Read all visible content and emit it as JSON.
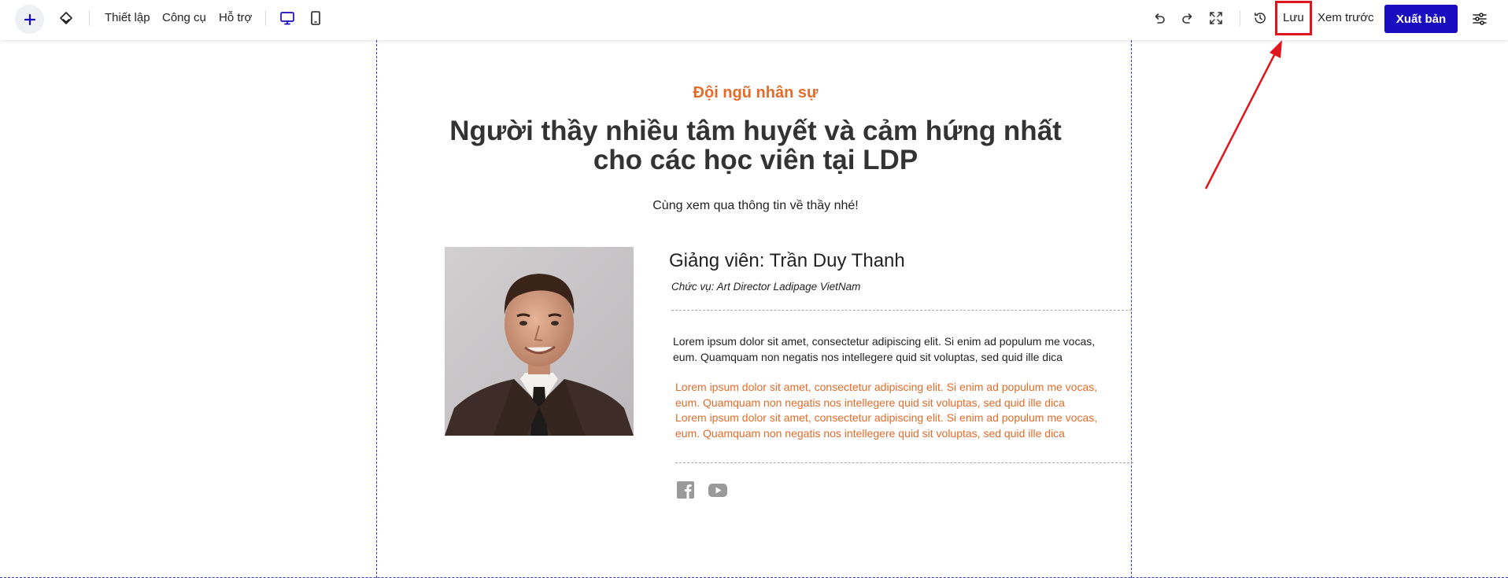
{
  "toolbar": {
    "menu": {
      "settings": "Thiết lập",
      "tools": "Công cụ",
      "support": "Hỗ trợ"
    },
    "save_label": "Lưu",
    "preview_label": "Xem trước",
    "publish_label": "Xuất bản",
    "icons": [
      "plus-icon",
      "layers-icon",
      "desktop-icon",
      "mobile-icon",
      "undo-icon",
      "redo-icon",
      "fullscreen-icon",
      "history-icon",
      "sliders-icon"
    ],
    "colors": {
      "accent": "#1a0dbf",
      "highlight": "#e0151e"
    }
  },
  "section": {
    "subtitle": "Đội ngũ nhân sự",
    "headline": "Người thầy nhiều tâm huyết và cảm hứng nhất cho các học viên tại LDP",
    "intro": "Cùng xem qua thông tin về thầy nhé!",
    "teacher": {
      "name": "Giảng viên: Trần Duy Thanh",
      "role": "Chức vụ: Art Director Ladipage VietNam",
      "bio": "Lorem ipsum dolor sit amet, consectetur adipiscing elit. Si enim ad populum me vocas, eum. Quamquam non negatis nos intellegere quid sit voluptas, sed quid ille dica",
      "highlight_1": "Lorem ipsum dolor sit amet, consectetur adipiscing elit. Si enim ad populum me vocas, eum. Quamquam non negatis nos intellegere quid sit voluptas, sed quid ille dica",
      "highlight_2": "Lorem ipsum dolor sit amet, consectetur adipiscing elit. Si enim ad populum me vocas, eum. Quamquam non negatis nos intellegere quid sit voluptas, sed quid ille dica"
    },
    "social_icons": [
      "facebook-icon",
      "youtube-icon"
    ],
    "colors": {
      "accent": "#e36c2b",
      "guide": "#3b35c8"
    }
  }
}
